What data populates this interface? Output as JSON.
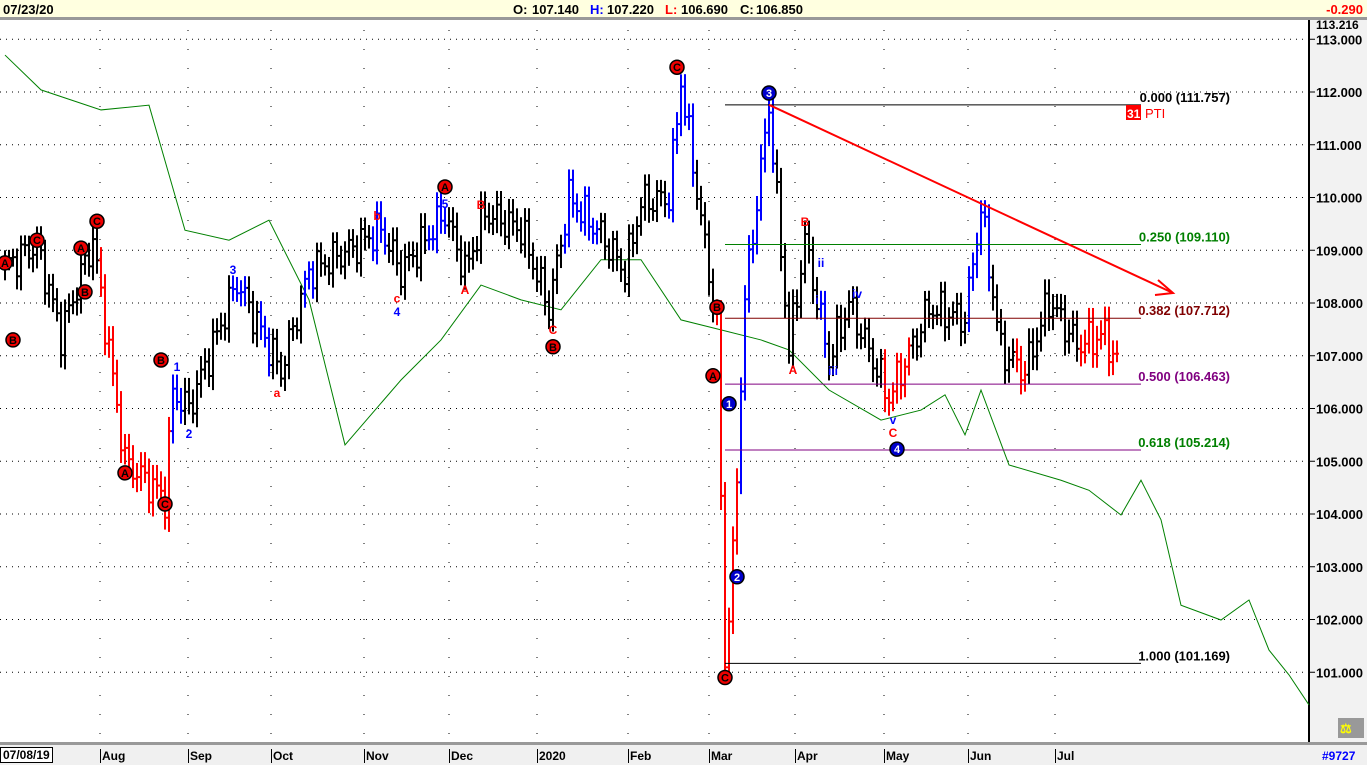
{
  "header": {
    "date": "07/23/20",
    "o_label": "O:",
    "o": "107.140",
    "h_label": "H:",
    "h": "107.220",
    "l_label": "L:",
    "l": "106.690",
    "c_label": "C:",
    "c": "106.850",
    "change": "-0.290"
  },
  "footer": {
    "start_date": "07/08/19",
    "months": [
      "Aug",
      "Sep",
      "Oct",
      "Nov",
      "Dec",
      "2020",
      "Feb",
      "Mar",
      "Apr",
      "May",
      "Jun",
      "Jul"
    ],
    "symbol": "#9727"
  },
  "indicator": {
    "badge": "31",
    "label": "PTI"
  },
  "colors": {
    "up": "#000000",
    "down": "#ff0000",
    "impulse": "#0000ff",
    "ma": "#008000",
    "trend": "#ff0000"
  },
  "chart_data": {
    "type": "bar",
    "x_unit": "trading day index",
    "ylim": [
      100.4,
      113.35
    ],
    "y_ticks": [
      "101.000",
      "102.000",
      "103.000",
      "104.000",
      "105.000",
      "106.000",
      "107.000",
      "108.000",
      "109.000",
      "110.000",
      "111.000",
      "112.000",
      "113.000"
    ],
    "y_top_label": "113.216",
    "price_anchors": [
      [
        0,
        108.7
      ],
      [
        8,
        109.1
      ],
      [
        14,
        107.4
      ],
      [
        22,
        109.2
      ],
      [
        30,
        105.0
      ],
      [
        40,
        104.3
      ],
      [
        42,
        106.3
      ],
      [
        46,
        106.0
      ],
      [
        58,
        108.4
      ],
      [
        69,
        106.7
      ],
      [
        76,
        108.6
      ],
      [
        86,
        109.0
      ],
      [
        94,
        109.4
      ],
      [
        99,
        108.6
      ],
      [
        110,
        109.7
      ],
      [
        115,
        108.6
      ],
      [
        120,
        109.7
      ],
      [
        129,
        109.4
      ],
      [
        136,
        107.9
      ],
      [
        141,
        110.0
      ],
      [
        149,
        109.3
      ],
      [
        155,
        108.6
      ],
      [
        159,
        109.9
      ],
      [
        166,
        110.0
      ],
      [
        169,
        112.2
      ],
      [
        174,
        109.6
      ],
      [
        178,
        107.5
      ],
      [
        180,
        101.2
      ],
      [
        182,
        103.1
      ],
      [
        185,
        108.1
      ],
      [
        191,
        111.75
      ],
      [
        194,
        109.0
      ],
      [
        196,
        107.1
      ],
      [
        200,
        109.2
      ],
      [
        206,
        106.9
      ],
      [
        211,
        108.0
      ],
      [
        221,
        106.2
      ],
      [
        231,
        107.9
      ],
      [
        240,
        107.7
      ],
      [
        244,
        109.8
      ],
      [
        249,
        107.1
      ],
      [
        255,
        106.7
      ],
      [
        261,
        108.05
      ],
      [
        268,
        107.2
      ],
      [
        275,
        107.4
      ],
      [
        278,
        106.85
      ]
    ],
    "red_ranges": [
      [
        24,
        41
      ],
      [
        178,
        183
      ],
      [
        220,
        226
      ],
      [
        253,
        255
      ],
      [
        269,
        278
      ]
    ],
    "blue_ranges": [
      [
        42,
        44
      ],
      [
        57,
        60
      ],
      [
        64,
        66
      ],
      [
        75,
        77
      ],
      [
        92,
        95
      ],
      [
        106,
        110
      ],
      [
        140,
        148
      ],
      [
        166,
        172
      ],
      [
        184,
        192
      ],
      [
        204,
        205
      ],
      [
        241,
        246
      ]
    ],
    "moving_average": [
      [
        0,
        112.7
      ],
      [
        9,
        112.04
      ],
      [
        24,
        111.66
      ],
      [
        36,
        111.75
      ],
      [
        45,
        109.38
      ],
      [
        56,
        109.19
      ],
      [
        66,
        109.57
      ],
      [
        76,
        108.06
      ],
      [
        85,
        105.31
      ],
      [
        99,
        106.54
      ],
      [
        109,
        107.3
      ],
      [
        119,
        108.34
      ],
      [
        129,
        108.06
      ],
      [
        139,
        107.87
      ],
      [
        149,
        108.82
      ],
      [
        159,
        108.82
      ],
      [
        169,
        107.68
      ],
      [
        179,
        107.49
      ],
      [
        189,
        107.3
      ],
      [
        196,
        107.11
      ],
      [
        206,
        106.35
      ],
      [
        219,
        105.78
      ],
      [
        229,
        105.97
      ],
      [
        235,
        106.26
      ],
      [
        240,
        105.5
      ],
      [
        244,
        106.35
      ],
      [
        251,
        104.93
      ],
      [
        264,
        104.64
      ],
      [
        271,
        104.45
      ],
      [
        279,
        103.98
      ],
      [
        284,
        104.64
      ],
      [
        289,
        103.89
      ],
      [
        294,
        102.27
      ],
      [
        304,
        101.99
      ],
      [
        311,
        102.37
      ],
      [
        316,
        101.42
      ],
      [
        321,
        100.95
      ],
      [
        326,
        100.38
      ]
    ],
    "fib_levels": [
      {
        "ratio": "0.000",
        "value": 111.757,
        "label": "0.000 (111.757)",
        "color": "#000000",
        "text": "#000000"
      },
      {
        "ratio": "0.250",
        "value": 109.11,
        "label": "0.250 (109.110)",
        "color": "#008000",
        "text": "#008000"
      },
      {
        "ratio": "0.382",
        "value": 107.712,
        "label": "0.382 (107.712)",
        "color": "#800000",
        "text": "#800000"
      },
      {
        "ratio": "0.500",
        "value": 106.463,
        "label": "0.500 (106.463)",
        "color": "#800080",
        "text": "#800080"
      },
      {
        "ratio": "0.618",
        "value": 105.214,
        "label": "0.618 (105.214)",
        "color": "#800080",
        "text": "#008000"
      },
      {
        "ratio": "1.000",
        "value": 101.169,
        "label": "1.000 (101.169)",
        "color": "#000000",
        "text": "#000000"
      }
    ],
    "fib_range": [
      180,
      284
    ],
    "trendline": [
      [
        191,
        111.757
      ],
      [
        292,
        108.19
      ]
    ],
    "wave_labels": [
      {
        "t": "A",
        "i": 0,
        "p": 108.76,
        "c": "red",
        "circle": true
      },
      {
        "t": "C",
        "i": 8,
        "p": 109.19,
        "c": "red",
        "circle": true
      },
      {
        "t": "A",
        "i": 19,
        "p": 109.04,
        "c": "red",
        "circle": true
      },
      {
        "t": "B",
        "i": 20,
        "p": 108.21,
        "c": "red",
        "circle": true
      },
      {
        "t": "C",
        "i": 23,
        "p": 109.55,
        "c": "red",
        "circle": true
      },
      {
        "t": "B",
        "i": 2,
        "p": 107.3,
        "c": "red",
        "circle": true
      },
      {
        "t": "A",
        "i": 30,
        "p": 104.78,
        "c": "red",
        "circle": true
      },
      {
        "t": "B",
        "i": 39,
        "p": 106.92,
        "c": "red",
        "circle": true
      },
      {
        "t": "C",
        "i": 40,
        "p": 104.19,
        "c": "red",
        "circle": true
      },
      {
        "t": "A",
        "i": 110,
        "p": 110.2,
        "c": "red",
        "circle": true
      },
      {
        "t": "B",
        "i": 137,
        "p": 107.17,
        "c": "red",
        "circle": true
      },
      {
        "t": "C",
        "i": 168,
        "p": 112.47,
        "c": "red",
        "circle": true
      },
      {
        "t": "B",
        "i": 178,
        "p": 107.92,
        "c": "red",
        "circle": true
      },
      {
        "t": "A",
        "i": 177,
        "p": 106.62,
        "c": "red",
        "circle": true
      },
      {
        "t": "C",
        "i": 180,
        "p": 100.9,
        "c": "red",
        "circle": true
      },
      {
        "t": "3",
        "i": 191,
        "p": 111.98,
        "c": "blue",
        "circle": true
      },
      {
        "t": "1",
        "i": 181,
        "p": 106.09,
        "c": "blue",
        "circle": true
      },
      {
        "t": "2",
        "i": 183,
        "p": 102.81,
        "c": "blue",
        "circle": true
      },
      {
        "t": "4",
        "i": 223,
        "p": 105.23,
        "c": "blue",
        "circle": true
      },
      {
        "t": "3",
        "i": 57,
        "p": 108.63,
        "c": "blue"
      },
      {
        "t": "1",
        "i": 43,
        "p": 106.79,
        "c": "blue"
      },
      {
        "t": "2",
        "i": 46,
        "p": 105.52,
        "c": "blue"
      },
      {
        "t": "a",
        "i": 68,
        "p": 106.29,
        "c": "red"
      },
      {
        "t": "b",
        "i": 93,
        "p": 109.65,
        "c": "red"
      },
      {
        "t": "c",
        "i": 98,
        "p": 108.09,
        "c": "red"
      },
      {
        "t": "4",
        "i": 98,
        "p": 107.83,
        "c": "blue"
      },
      {
        "t": "5",
        "i": 110,
        "p": 109.88,
        "c": "blue"
      },
      {
        "t": "B",
        "i": 119,
        "p": 109.86,
        "c": "red"
      },
      {
        "t": "A",
        "i": 115,
        "p": 108.25,
        "c": "red"
      },
      {
        "t": "C",
        "i": 137,
        "p": 107.49,
        "c": "red"
      },
      {
        "t": "B",
        "i": 200,
        "p": 109.54,
        "c": "red"
      },
      {
        "t": "A",
        "i": 197,
        "p": 106.73,
        "c": "red"
      },
      {
        "t": "ii",
        "i": 204,
        "p": 108.76,
        "c": "blue"
      },
      {
        "t": "i",
        "i": 203,
        "p": 108.06,
        "c": "blue"
      },
      {
        "t": "iii",
        "i": 207,
        "p": 106.71,
        "c": "blue"
      },
      {
        "t": "iv",
        "i": 213,
        "p": 108.17,
        "c": "blue"
      },
      {
        "t": "v",
        "i": 222,
        "p": 105.78,
        "c": "blue"
      },
      {
        "t": "C",
        "i": 222,
        "p": 105.54,
        "c": "red"
      }
    ]
  }
}
